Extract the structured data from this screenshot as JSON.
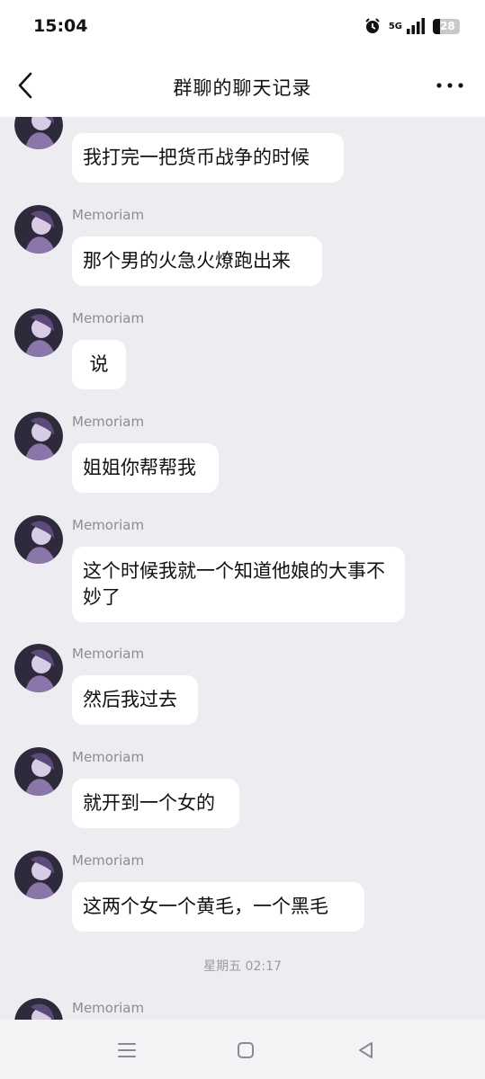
{
  "status_bar": {
    "time": "15:04",
    "network": "5G",
    "battery": "28"
  },
  "header": {
    "title": "群聊的聊天记录"
  },
  "messages": [
    {
      "sender": "Memoriam",
      "text": "我打完一把货币战争的时候"
    },
    {
      "sender": "Memoriam",
      "text": "那个男的火急火燎跑出来"
    },
    {
      "sender": "Memoriam",
      "text": "说"
    },
    {
      "sender": "Memoriam",
      "text": "姐姐你帮帮我"
    },
    {
      "sender": "Memoriam",
      "text": "这个时候我就一个知道他娘的大事不妙了"
    },
    {
      "sender": "Memoriam",
      "text": "然后我过去"
    },
    {
      "sender": "Memoriam",
      "text": "就开到一个女的"
    },
    {
      "sender": "Memoriam",
      "text": "这两个女一个黄毛，一个黑毛"
    },
    {
      "sender": "Memoriam",
      "text": ""
    }
  ],
  "timestamp": "星期五 02:17"
}
